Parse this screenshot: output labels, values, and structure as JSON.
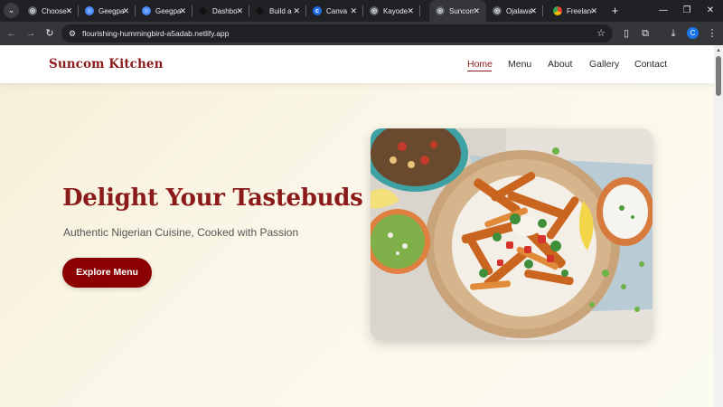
{
  "browser": {
    "tabs": [
      {
        "title": "Choose",
        "favicon": "generic-icon",
        "color": "#9aa0a6",
        "active": false
      },
      {
        "title": "Geegpay",
        "favicon": "geegpay-icon",
        "color": "#4c8bf5",
        "active": false
      },
      {
        "title": "Geegpay",
        "favicon": "geegpay-icon",
        "color": "#4c8bf5",
        "active": false
      },
      {
        "title": "Dashboard",
        "favicon": "diamond-icon",
        "color": "#111111",
        "active": false
      },
      {
        "title": "Build a",
        "favicon": "diamond-icon",
        "color": "#111111",
        "active": false
      },
      {
        "title": "Canva",
        "favicon": "canva-icon",
        "color": "#1f6fe5",
        "active": false
      },
      {
        "title": "Kayode",
        "favicon": "globe-icon",
        "color": "#9aa0a6",
        "active": false
      },
      {
        "title": "Suncom",
        "favicon": "globe-icon",
        "color": "#9aa0a6",
        "active": true
      },
      {
        "title": "Ojalawa",
        "favicon": "globe-icon",
        "color": "#9aa0a6",
        "active": false
      },
      {
        "title": "Freelance",
        "favicon": "chrome-icon",
        "color": "#ea4335",
        "active": false
      }
    ],
    "url": "flourishing-hummingbird-a5adab.netlify.app",
    "profile_initial": "C"
  },
  "site": {
    "logo": "Suncom Kitchen",
    "nav": [
      "Home",
      "Menu",
      "About",
      "Gallery",
      "Contact"
    ],
    "active_nav": "Home"
  },
  "hero": {
    "title": "Delight Your Tastebuds",
    "subtitle": "Authentic Nigerian Cuisine, Cooked with Passion",
    "cta_label": "Explore Menu"
  },
  "colors": {
    "brand": "#8b1a1a",
    "cta": "#8b0000",
    "hero_bg": "#fbf7e6"
  }
}
